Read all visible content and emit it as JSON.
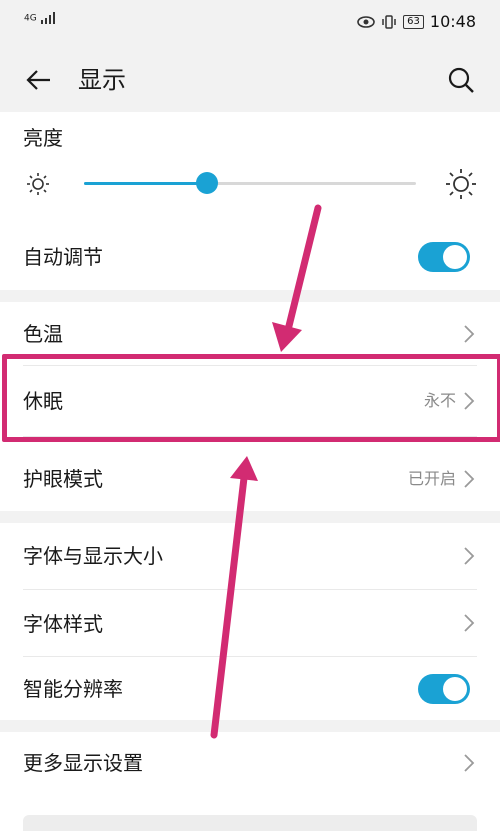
{
  "status_bar": {
    "network": "4G",
    "battery": "63",
    "time": "10:48",
    "icons": [
      "signal-icon",
      "eye-icon",
      "vibrate-icon",
      "battery-icon"
    ]
  },
  "header": {
    "title": "显示",
    "back_icon": "arrow-left-icon",
    "search_icon": "search-icon"
  },
  "brightness": {
    "label": "亮度",
    "level": 0.37
  },
  "auto_adjust": {
    "label": "自动调节",
    "enabled": true
  },
  "color_temp": {
    "label": "色温"
  },
  "sleep": {
    "label": "休眠",
    "value": "永不"
  },
  "eye_comfort": {
    "label": "护眼模式",
    "value": "已开启"
  },
  "font_size": {
    "label": "字体与显示大小"
  },
  "font_style": {
    "label": "字体样式"
  },
  "smart_resolution": {
    "label": "智能分辨率",
    "enabled": true
  },
  "more_settings": {
    "label": "更多显示设置"
  },
  "colors": {
    "accent": "#1aa2d4",
    "annotation": "#d22b72",
    "background": "#f2f2f2"
  }
}
